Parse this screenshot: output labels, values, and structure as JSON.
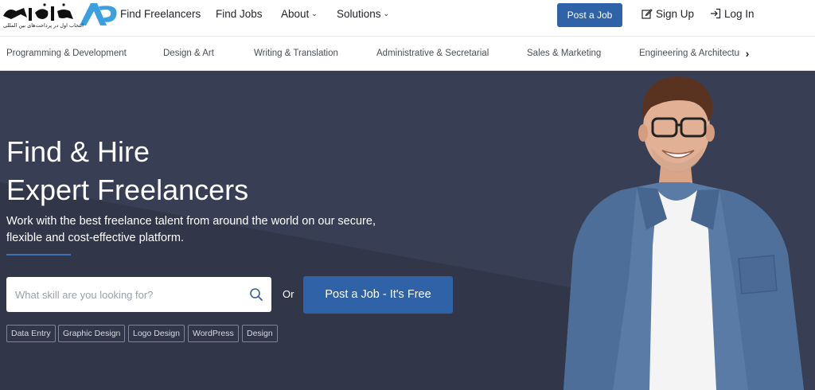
{
  "logo": {
    "brand": "ایران پروژه",
    "tagline": "انتخاب اول در پرداخت‌های بین المللی",
    "mark": "ap"
  },
  "nav": {
    "find_freelancers": "Find Freelancers",
    "find_jobs": "Find Jobs",
    "about": "About",
    "solutions": "Solutions",
    "post_job": "Post a Job",
    "sign_up": "Sign Up",
    "log_in": "Log In"
  },
  "categories": [
    "Programming & Development",
    "Design & Art",
    "Writing & Translation",
    "Administrative & Secretarial",
    "Sales & Marketing",
    "Engineering & Architecture"
  ],
  "hero": {
    "title_line1": "Find & Hire",
    "title_line2": "Expert Freelancers",
    "subtitle": "Work with the best freelance talent from around the world on our secure, flexible and cost-effective platform.",
    "search_placeholder": "What skill are you looking for?",
    "or": "Or",
    "post_job_cta": "Post a Job - It's Free",
    "tags": [
      "Data Entry",
      "Graphic Design",
      "Logo Design",
      "WordPress",
      "Design"
    ]
  },
  "icons": {
    "search": "search-icon",
    "sign_up": "edit-icon",
    "log_in": "login-icon",
    "next": "chevron-right-icon",
    "dropdown": "chevron-down-icon"
  },
  "colors": {
    "primary": "#2f62a6",
    "hero_bg": "#343b4e",
    "accent_line": "#3d6fb6",
    "logo_blue": "#3aa0e0"
  }
}
